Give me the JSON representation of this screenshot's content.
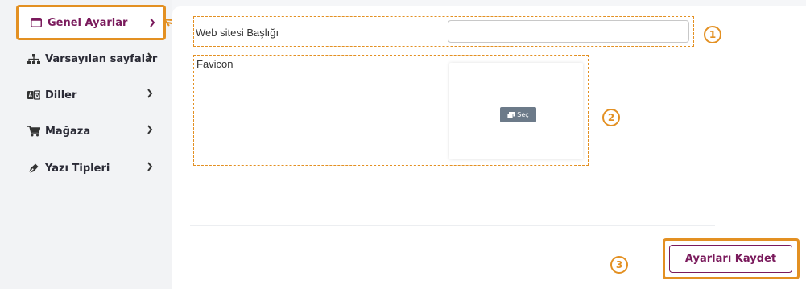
{
  "sidebar": {
    "items": [
      {
        "label": "Genel Ayarlar",
        "icon": "window-icon",
        "active": true
      },
      {
        "label": "Varsayılan sayfalar",
        "icon": "sitemap-icon"
      },
      {
        "label": "Diller",
        "icon": "language-icon"
      },
      {
        "label": "Mağaza",
        "icon": "cart-icon"
      },
      {
        "label": "Yazı Tipleri",
        "icon": "pen-icon"
      }
    ],
    "chevron": "›"
  },
  "form": {
    "site_title_label": "Web sitesi Başlığı",
    "site_title_value": "",
    "favicon_label": "Favicon",
    "choose_button_label": "Seç"
  },
  "save_button_label": "Ayarları Kaydet",
  "callouts": [
    "1",
    "2",
    "3"
  ],
  "colors": {
    "accent": "#e39022",
    "brand": "#7a1a5c",
    "button_gray": "#6c7a89"
  }
}
